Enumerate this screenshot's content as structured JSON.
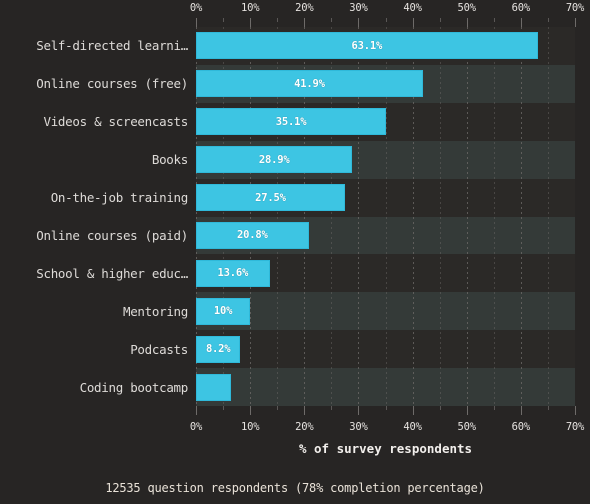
{
  "chart_data": {
    "type": "bar",
    "orientation": "horizontal",
    "title": "",
    "xlabel": "% of survey respondents",
    "ylabel": "",
    "xlim": [
      0,
      70
    ],
    "grid": true,
    "legend": null,
    "categories": [
      "Self-directed learni…",
      "Online courses (free)",
      "Videos & screencasts",
      "Books",
      "On-the-job training",
      "Online courses (paid)",
      "School & higher educ…",
      "Mentoring",
      "Podcasts",
      "Coding bootcamp"
    ],
    "values": [
      63.1,
      41.9,
      35.1,
      28.9,
      27.5,
      20.8,
      13.6,
      10,
      8.2,
      6.5
    ],
    "value_labels": [
      "63.1%",
      "41.9%",
      "35.1%",
      "28.9%",
      "27.5%",
      "20.8%",
      "13.6%",
      "10%",
      "8.2%",
      ""
    ],
    "xticks": [
      0,
      10,
      20,
      30,
      40,
      50,
      60,
      70
    ],
    "xticklabels": [
      "0%",
      "10%",
      "20%",
      "30%",
      "40%",
      "50%",
      "60%",
      "70%"
    ],
    "xminorticks": [
      5,
      15,
      25,
      35,
      45,
      55,
      65
    ],
    "colors": {
      "bar": "#3dc5e3",
      "bar_edge": "#2fb9da",
      "background": "#272524",
      "band_dark": "#2b2927",
      "band_light": "#343a38",
      "text": "#e8e6e3",
      "value_text": "#ffffff",
      "footer_text": "#e9e2d8",
      "grid": "#6d6a68"
    }
  },
  "footer": {
    "note": "12535 question respondents (78% completion percentage)"
  },
  "axis": {
    "x_title": "% of survey respondents"
  }
}
